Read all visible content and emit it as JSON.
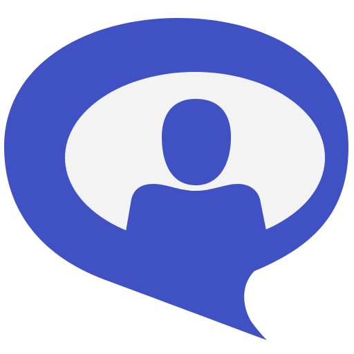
{
  "icon": {
    "name": "chat-bubble-user-icon",
    "colors": {
      "background": "#ffffff",
      "bubble": "#3f51c3",
      "inner": "#f3f3f3",
      "person": "#3f51c3"
    }
  }
}
